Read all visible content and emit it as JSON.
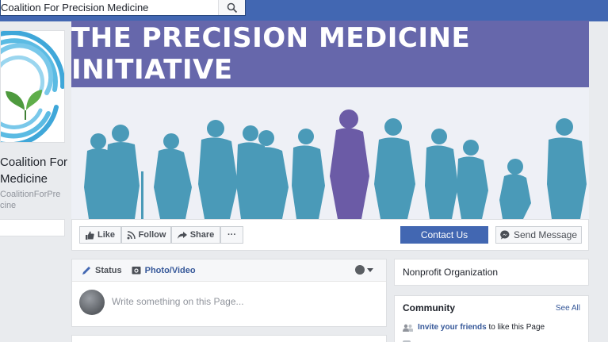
{
  "search": {
    "value": "Coalition For Precision Medicine",
    "icon": "search-icon"
  },
  "profile": {
    "name_line1": "Coalition For",
    "name_line2": "Medicine",
    "username_line1": "CoalitionForPre",
    "username_line2": "cine"
  },
  "cover": {
    "banner_text": "THE PRECISION MEDICINE INITIATIVE",
    "banner_color": "#6667ab",
    "people_color": "#4a9ab8",
    "highlight_color": "#6b5ba6"
  },
  "actions": {
    "like": "Like",
    "follow": "Follow",
    "share": "Share",
    "more": "···",
    "contact": "Contact Us",
    "send_message": "Send Message"
  },
  "composer": {
    "status_tab": "Status",
    "photo_tab": "Photo/Video",
    "placeholder": "Write something on this Page..."
  },
  "sidebar": {
    "category": "Nonprofit Organization",
    "community_title": "Community",
    "see_all": "See All",
    "invite_link": "Invite your friends",
    "invite_rest": " to like this Page"
  },
  "colors": {
    "facebook_blue": "#4267b2",
    "link": "#365899"
  }
}
